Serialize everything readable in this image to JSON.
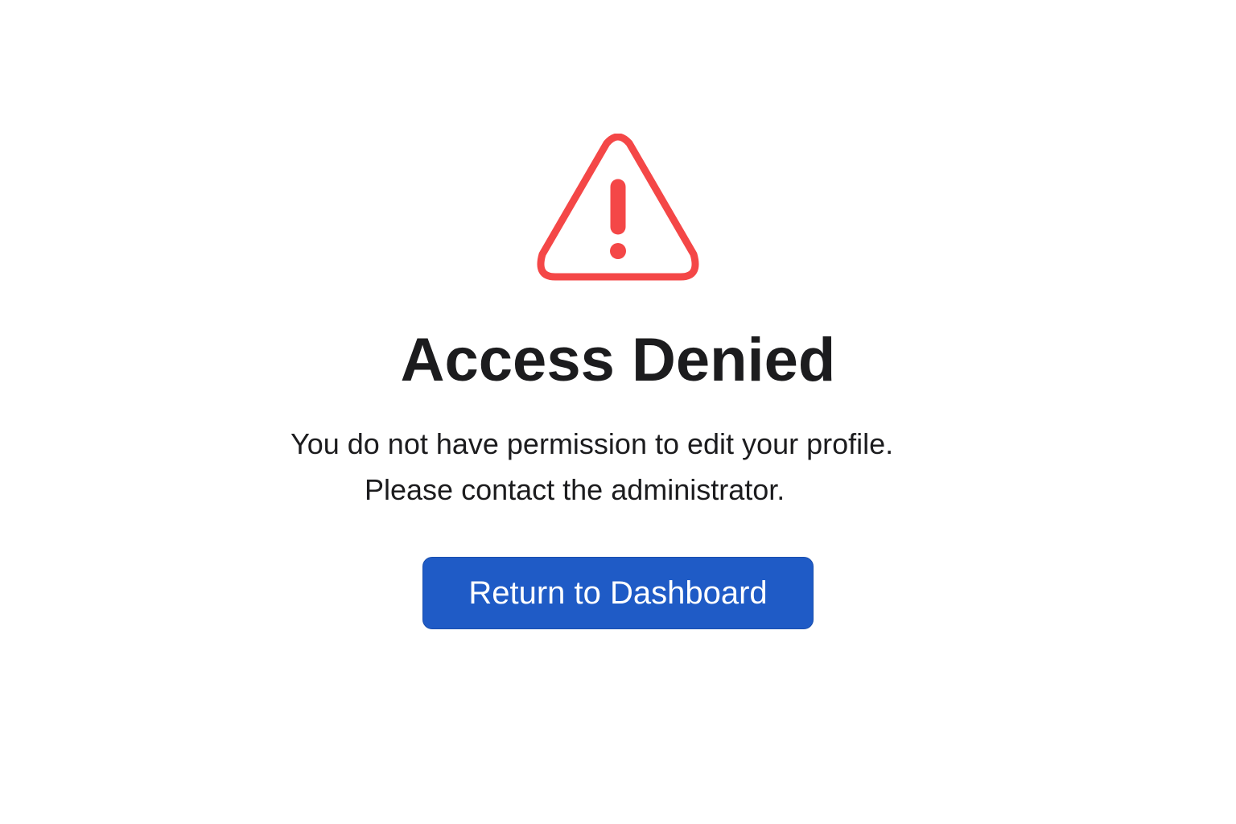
{
  "icon": {
    "name": "warning-triangle-icon",
    "color": "#f44747"
  },
  "heading": {
    "title": "Access Denied"
  },
  "message": {
    "line1": "You do not have permission to edit your profile.",
    "line2": "Please contact the administrator."
  },
  "actions": {
    "return_label": "Return to Dashboard",
    "button_color": "#1f5bc6"
  }
}
